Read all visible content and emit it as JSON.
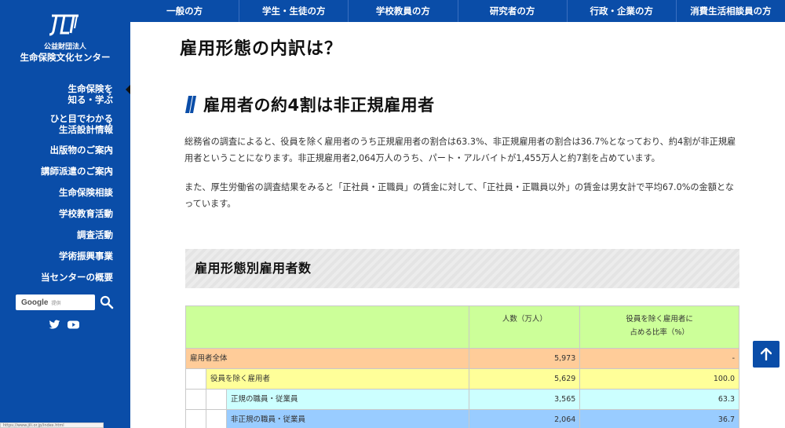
{
  "sidebar": {
    "org_small": "公益財団法人",
    "org_name": "生命保険文化センター",
    "items": [
      {
        "label": "生命保険を\n知る・学ぶ"
      },
      {
        "label": "ひと目でわかる\n生活設計情報"
      },
      {
        "label": "出版物のご案内"
      },
      {
        "label": "講師派遣のご案内"
      },
      {
        "label": "生命保険相談"
      },
      {
        "label": "学校教育活動"
      },
      {
        "label": "調査活動"
      },
      {
        "label": "学術振興事業"
      },
      {
        "label": "当センターの概要"
      }
    ],
    "search_label": "Google",
    "search_sub": "提供"
  },
  "topnav": {
    "items": [
      "一般の方",
      "学生・生徒の方",
      "学校教員の方",
      "研究者の方",
      "行政・企業の方",
      "消費生活相談員の方"
    ]
  },
  "main": {
    "heading1": "雇用形態の内訳は？",
    "heading2": "雇用者の約4割は非正規雇用者",
    "para1": "総務省の調査によると、役員を除く雇用者のうち正規雇用者の割合は63.3%、非正規雇用者の割合は36.7%となっており、約4割が非正規雇用者ということになります。非正規雇用者2,064万人のうち、パート・アルバイトが1,455万人と約7割を占めています。",
    "para2": "また、厚生労働省の調査結果をみると「正社員・正職員」の賃金に対して、「正社員・正職員以外」の賃金は男女計で平均67.0%の金額となっています。",
    "subhead": "雇用形態別雇用者数"
  },
  "table": {
    "header": {
      "num": "人数（万人）",
      "rate": "役員を除く雇用者に\n占める比率（%）"
    },
    "rows": [
      {
        "label": "雇用者全体",
        "num": "5,973",
        "rate": "-"
      },
      {
        "label": "役員を除く雇用者",
        "num": "5,629",
        "rate": "100.0"
      },
      {
        "label": "正規の職員・従業員",
        "num": "3,565",
        "rate": "63.3"
      },
      {
        "label": "非正規の職員・従業員",
        "num": "2,064",
        "rate": "36.7"
      }
    ],
    "colors": {
      "header": "#ccff99",
      "row0": "#ffcc99",
      "row1": "#ffff99",
      "row2": "#ccffff",
      "row3": "#99ccff"
    }
  },
  "statusbar": "https://www.jili.or.jp/index.html",
  "icons": [
    "logo-icon",
    "chevron-right-icon",
    "search-icon",
    "twitter-icon",
    "youtube-icon",
    "arrow-up-icon"
  ]
}
